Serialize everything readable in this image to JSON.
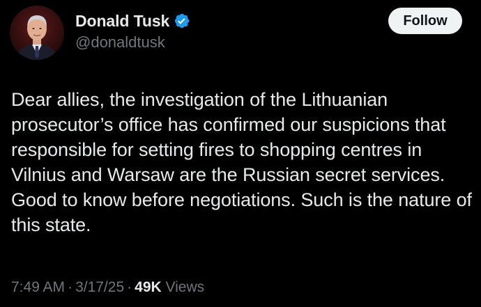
{
  "author": {
    "display_name": "Donald Tusk",
    "handle": "@donaldtusk",
    "verified": true,
    "verified_badge_color": "#1d9bf0",
    "avatar_icon": "profile-photo"
  },
  "follow_button": {
    "label": "Follow"
  },
  "tweet": {
    "text": "Dear allies, the investigation of the Lithuanian prosecutor’s office has confirmed our suspicions that responsible for setting fires to shopping centres in Vilnius and Warsaw are the Russian secret services. Good to know before negotiations. Such is the nature of this state."
  },
  "meta": {
    "time": "7:49 AM",
    "separator": "·",
    "date": "3/17/25",
    "views_count": "49K",
    "views_label": "Views"
  },
  "colors": {
    "background": "#000000",
    "primary_text": "#e7e9ea",
    "secondary_text": "#71767b",
    "button_bg": "#eff3f4",
    "button_text": "#0f1419"
  }
}
